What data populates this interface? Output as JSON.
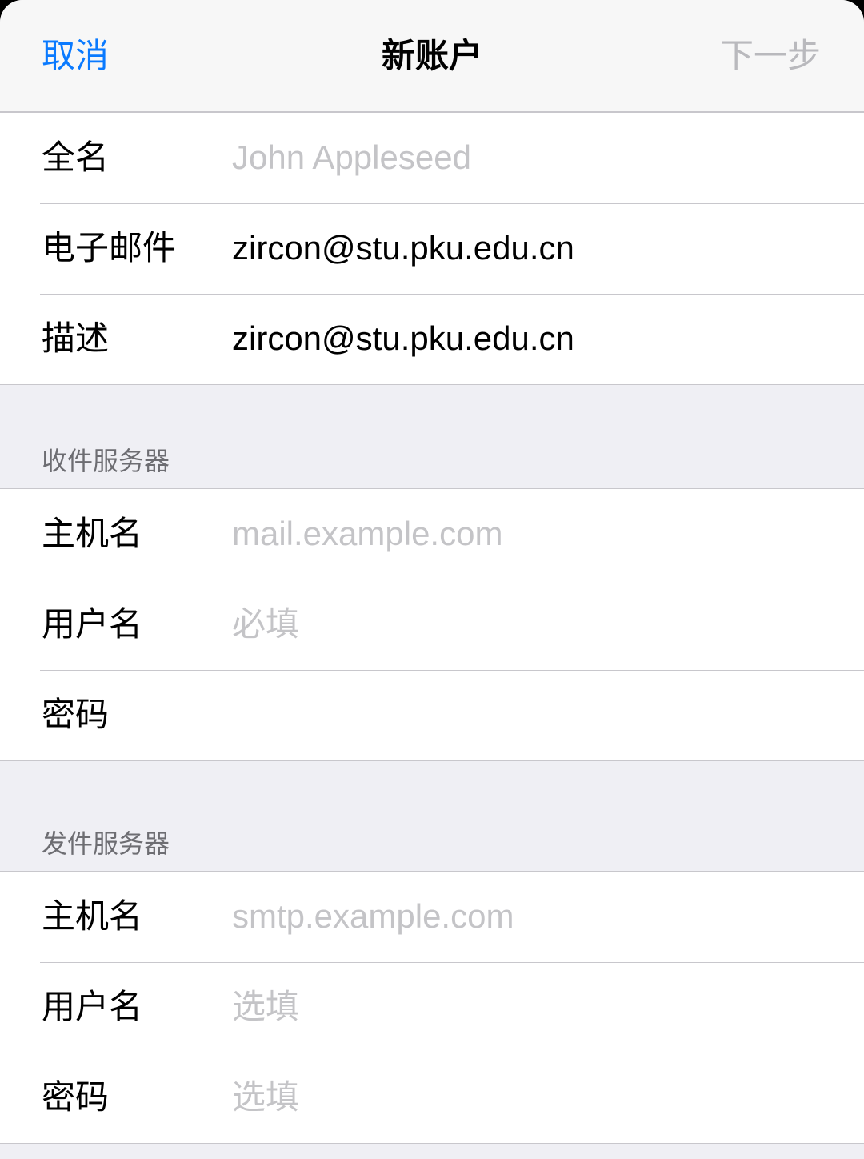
{
  "navbar": {
    "cancel_label": "取消",
    "title": "新账户",
    "next_label": "下一步"
  },
  "account": {
    "fullname": {
      "label": "全名",
      "value": "",
      "placeholder": "John Appleseed"
    },
    "email": {
      "label": "电子邮件",
      "value": "zircon@stu.pku.edu.cn",
      "placeholder": ""
    },
    "description": {
      "label": "描述",
      "value": "zircon@stu.pku.edu.cn",
      "placeholder": ""
    }
  },
  "incoming": {
    "header": "收件服务器",
    "hostname": {
      "label": "主机名",
      "value": "",
      "placeholder": "mail.example.com"
    },
    "username": {
      "label": "用户名",
      "value": "",
      "placeholder": "必填"
    },
    "password": {
      "label": "密码",
      "value": "",
      "placeholder": ""
    }
  },
  "outgoing": {
    "header": "发件服务器",
    "hostname": {
      "label": "主机名",
      "value": "",
      "placeholder": "smtp.example.com"
    },
    "username": {
      "label": "用户名",
      "value": "",
      "placeholder": "选填"
    },
    "password": {
      "label": "密码",
      "value": "",
      "placeholder": "选填"
    }
  },
  "colors": {
    "accent": "#0a7aff",
    "disabled": "#b9b9bd",
    "placeholder": "#c4c4c7",
    "group_background": "#efeff4",
    "separator": "#c8c7cc"
  }
}
